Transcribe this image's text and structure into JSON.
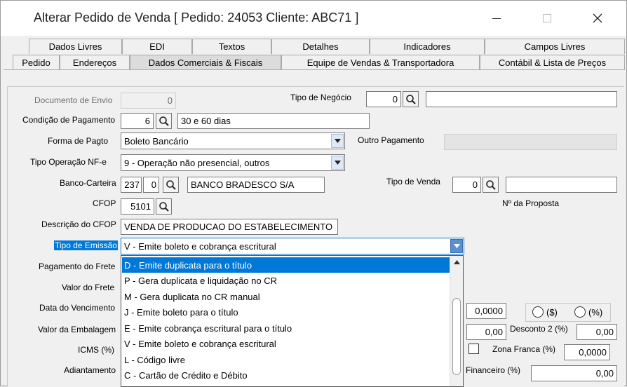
{
  "window": {
    "title": "Alterar Pedido de Venda [ Pedido: 24053 Cliente: ABC71 ]"
  },
  "tabs_row1": [
    "Dados Livres",
    "EDI",
    "Textos",
    "Detalhes",
    "Indicadores",
    "Campos Livres"
  ],
  "tabs_row2": [
    "Pedido",
    "Endereços",
    "Dados Comerciais & Fiscais",
    "Equipe de Vendas & Transportadora",
    "Contábil & Lista de Preços"
  ],
  "form": {
    "documento_envio": {
      "label": "Documento de Envio",
      "value": "0"
    },
    "tipo_negocio": {
      "label": "Tipo de Negócio",
      "code": "0",
      "desc": ""
    },
    "condicao_pagamento": {
      "label": "Condição de Pagamento",
      "code": "6",
      "desc": "30 e 60 dias"
    },
    "forma_pagto": {
      "label": "Forma de Pagto",
      "value": "Boleto Bancário"
    },
    "outro_pagamento": {
      "label": "Outro Pagamento",
      "value": ""
    },
    "tipo_operacao": {
      "label": "Tipo Operação NF-e",
      "value": "9 - Operação não presencial, outros"
    },
    "banco_carteira": {
      "label": "Banco-Carteira",
      "banco": "237",
      "carteira": "0",
      "desc": "BANCO BRADESCO S/A"
    },
    "tipo_venda": {
      "label": "Tipo de Venda",
      "code": "0",
      "desc": ""
    },
    "cfop": {
      "label": "CFOP",
      "value": "5101"
    },
    "numero_proposta": {
      "label": "Nº da Proposta"
    },
    "descricao_cfop": {
      "label": "Descrição do CFOP",
      "value": "VENDA DE PRODUCAO DO ESTABELECIMENTO"
    },
    "tipo_emissao": {
      "label": "Tipo de Emissão",
      "value": "V - Emite boleto e cobrança escritural"
    },
    "pagamento_frete": {
      "label": "Pagamento do Frete"
    },
    "valor_frete": {
      "label": "Valor do Frete"
    },
    "data_vencimento": {
      "label": "Data do Vencimento"
    },
    "valor_embalagem": {
      "label": "Valor da Embalagem"
    },
    "icms": {
      "label": "ICMS (%)"
    },
    "adiantamento": {
      "label": "Adiantamento"
    },
    "right_value_1": "0,0000",
    "right_value_2": "0,00",
    "desconto2": {
      "label": "Desconto 2 (%)",
      "value": "0,00"
    },
    "zona_franca": {
      "label": "Zona Franca (%)",
      "value": "0,0000"
    },
    "financeiro": {
      "label": "Financeiro (%)",
      "value": "0,00"
    },
    "radio_valor": "($)",
    "radio_pct": "(%)"
  },
  "dropdown_options": [
    "D - Emite duplicata para o título",
    "P - Gera duplicata e liquidação no CR",
    "M - Gera duplicata no CR manual",
    "J  - Emite boleto para o título",
    "E - Emite cobrança escritural para o título",
    "V - Emite boleto e cobrança escritural",
    "L - Código livre",
    "C - Cartão de Crédito e Débito"
  ],
  "colors": {
    "selection": "#0078d7"
  }
}
